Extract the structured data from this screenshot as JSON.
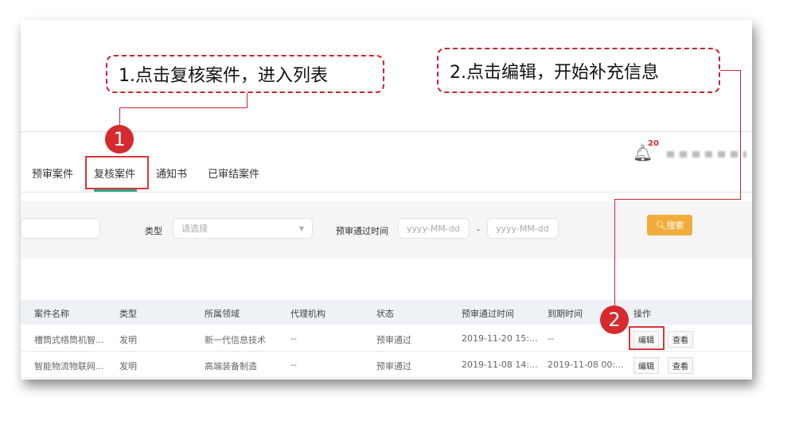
{
  "annotations": {
    "step1": "1.点击复核案件，进入列表",
    "step2": "2.点击编辑，开始补充信息",
    "marker1": "1",
    "marker2": "2"
  },
  "header": {
    "tabs": [
      "预审案件",
      "复核案件",
      "通知书",
      "已审结案件"
    ],
    "active_tab": 1,
    "notification_count": "20"
  },
  "filters": {
    "type_label": "类型",
    "type_placeholder": "请选择",
    "date_label": "预审通过时间",
    "date_from_placeholder": "yyyy-MM-dd",
    "date_sep": "-",
    "date_to_placeholder": "yyyy-MM-dd",
    "search_label": "搜索"
  },
  "table": {
    "headers": [
      "案件名称",
      "类型",
      "所属领域",
      "代理机构",
      "状态",
      "预审通过时间",
      "到期时间",
      "操作"
    ],
    "rows": [
      {
        "name": "槽筒式络筒机智...",
        "type": "发明",
        "field": "新一代信息技术",
        "agency": "--",
        "status": "预审通过",
        "pass_time": "2019-11-20 15:...",
        "due": "--",
        "edit": "编辑",
        "view": "查看"
      },
      {
        "name": "智能物流物联网...",
        "type": "发明",
        "field": "高端装备制造",
        "agency": "--",
        "status": "预审通过",
        "pass_time": "2019-11-08 14:...",
        "due": "2019-11-08 00:...",
        "edit": "编辑",
        "view": "查看"
      }
    ]
  },
  "colors": {
    "accent_red": "#d62a2e",
    "search_button": "#f0ad3c",
    "active_tab_underline": "#2aa889"
  }
}
